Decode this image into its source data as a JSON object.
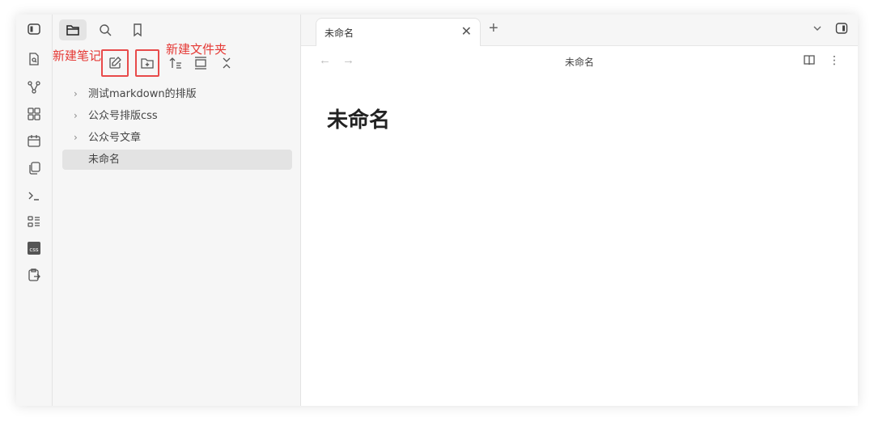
{
  "ribbon": {
    "icons": [
      "sidebar-toggle-icon",
      "open-quick-switcher-icon",
      "graph-view-icon",
      "canvas-icon",
      "daily-note-icon",
      "templates-icon",
      "command-palette-icon",
      "outline-icon",
      "css-icon",
      "export-icon"
    ],
    "css_label": "css"
  },
  "sidebar": {
    "tabs": [
      "files-tab",
      "search-tab",
      "bookmarks-tab"
    ],
    "annotations": {
      "new_note": "新建笔记",
      "new_folder": "新建文件夹"
    },
    "tree": [
      {
        "label": "测试markdown的排版",
        "type": "folder"
      },
      {
        "label": "公众号排版css",
        "type": "folder"
      },
      {
        "label": "公众号文章",
        "type": "folder"
      },
      {
        "label": "未命名",
        "type": "file",
        "selected": true
      }
    ]
  },
  "tabs": {
    "active_title": "未命名",
    "close_glyph": "✕",
    "new_tab_glyph": "+"
  },
  "view": {
    "back_glyph": "←",
    "forward_glyph": "→",
    "title": "未命名",
    "more_glyph": "⋮"
  },
  "note": {
    "heading": "未命名"
  },
  "colors": {
    "annotation": "#e53935",
    "sidebar_bg": "#f6f6f6",
    "selected_bg": "#e3e3e3"
  }
}
